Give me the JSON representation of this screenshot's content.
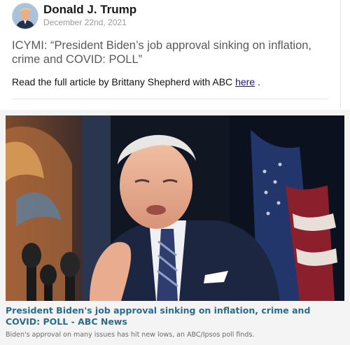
{
  "post": {
    "author": "Donald J. Trump",
    "date": "December 22nd, 2021",
    "headline": "ICYMI: “President Biden’s job approval sinking on inflation, crime and COVID: POLL”",
    "body_prefix": "Read the full article by Brittany Shepherd with ABC",
    "link_text": "here",
    "body_suffix": "."
  },
  "card": {
    "title": "President Biden's job approval sinking on inflation, crime and COVID: POLL - ABC News",
    "description": "Biden's approval on many issues has hit new lows, an ABC/Ipsos poll finds."
  },
  "colors": {
    "link": "#1a0dab",
    "card_title": "#2b6c8c",
    "card_bg": "#f4f4f4"
  }
}
